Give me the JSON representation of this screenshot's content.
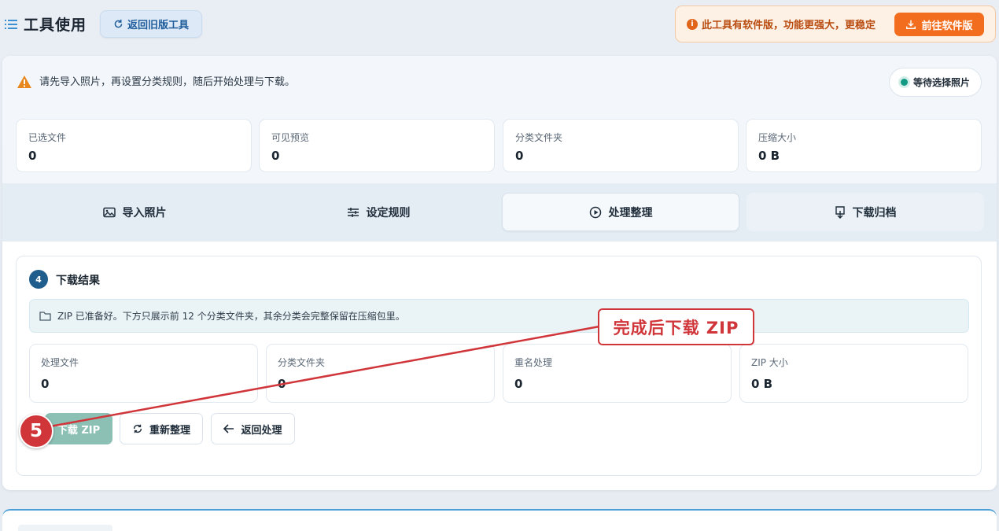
{
  "header": {
    "title": "工具使用",
    "old_tool_label": "返回旧版工具",
    "promo_text": "此工具有软件版，功能更强大，更稳定",
    "promo_button": "前往软件版"
  },
  "notice": {
    "text": "请先导入照片，再设置分类规则，随后开始处理与下载。",
    "status": "等待选择照片"
  },
  "stats": [
    {
      "label": "已选文件",
      "value": "0"
    },
    {
      "label": "可见预览",
      "value": "0"
    },
    {
      "label": "分类文件夹",
      "value": "0"
    },
    {
      "label": "压缩大小",
      "value": "0 B"
    }
  ],
  "tabs": [
    {
      "label": "导入照片",
      "icon": "image-icon"
    },
    {
      "label": "设定规则",
      "icon": "sliders-icon"
    },
    {
      "label": "处理整理",
      "icon": "play-icon"
    },
    {
      "label": "下载归档",
      "icon": "download-icon"
    }
  ],
  "result": {
    "step": "4",
    "title": "下载结果",
    "info": "ZIP 已准备好。下方只展示前 12 个分类文件夹，其余分类会完整保留在压缩包里。",
    "stats": [
      {
        "label": "处理文件",
        "value": "0"
      },
      {
        "label": "分类文件夹",
        "value": "0"
      },
      {
        "label": "重名处理",
        "value": "0"
      },
      {
        "label": "ZIP 大小",
        "value": "0 B"
      }
    ],
    "buttons": {
      "download": "下载 ZIP",
      "reorganize": "重新整理",
      "back": "返回处理"
    }
  },
  "annotation": {
    "callout": "完成后下载 ZIP",
    "step_badge": "5",
    "color": "#d0353a"
  }
}
